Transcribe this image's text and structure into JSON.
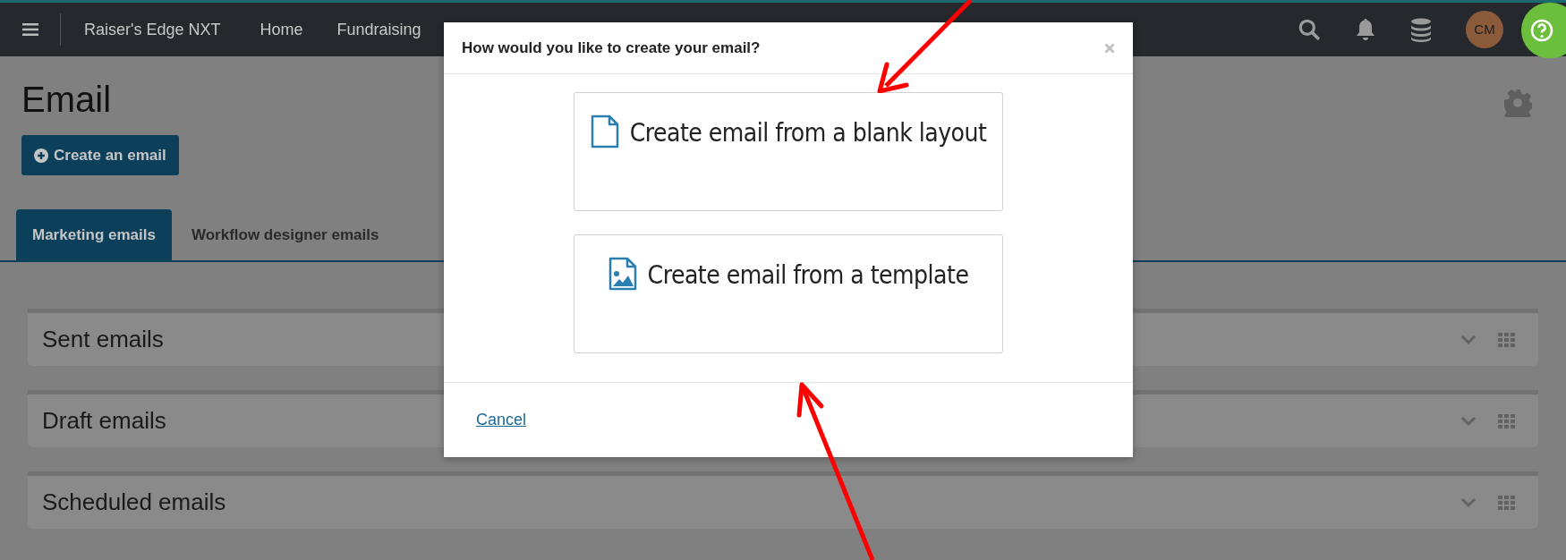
{
  "topbar": {
    "app_name": "Raiser's Edge NXT",
    "nav": [
      {
        "label": "Home"
      },
      {
        "label": "Fundraising"
      }
    ],
    "avatar": "CM"
  },
  "page": {
    "title": "Email",
    "create_button": "Create an email",
    "tabs": [
      {
        "label": "Marketing emails",
        "selected": true
      },
      {
        "label": "Workflow designer emails",
        "selected": false
      }
    ],
    "sections": [
      {
        "title": "Sent emails"
      },
      {
        "title": "Draft emails"
      },
      {
        "title": "Scheduled emails"
      }
    ]
  },
  "dialog": {
    "title": "How would you like to create your email?",
    "options": [
      {
        "kind": "blank",
        "label": "Create email from a blank layout"
      },
      {
        "kind": "template",
        "label": "Create email from a template"
      }
    ],
    "cancel": "Cancel"
  }
}
